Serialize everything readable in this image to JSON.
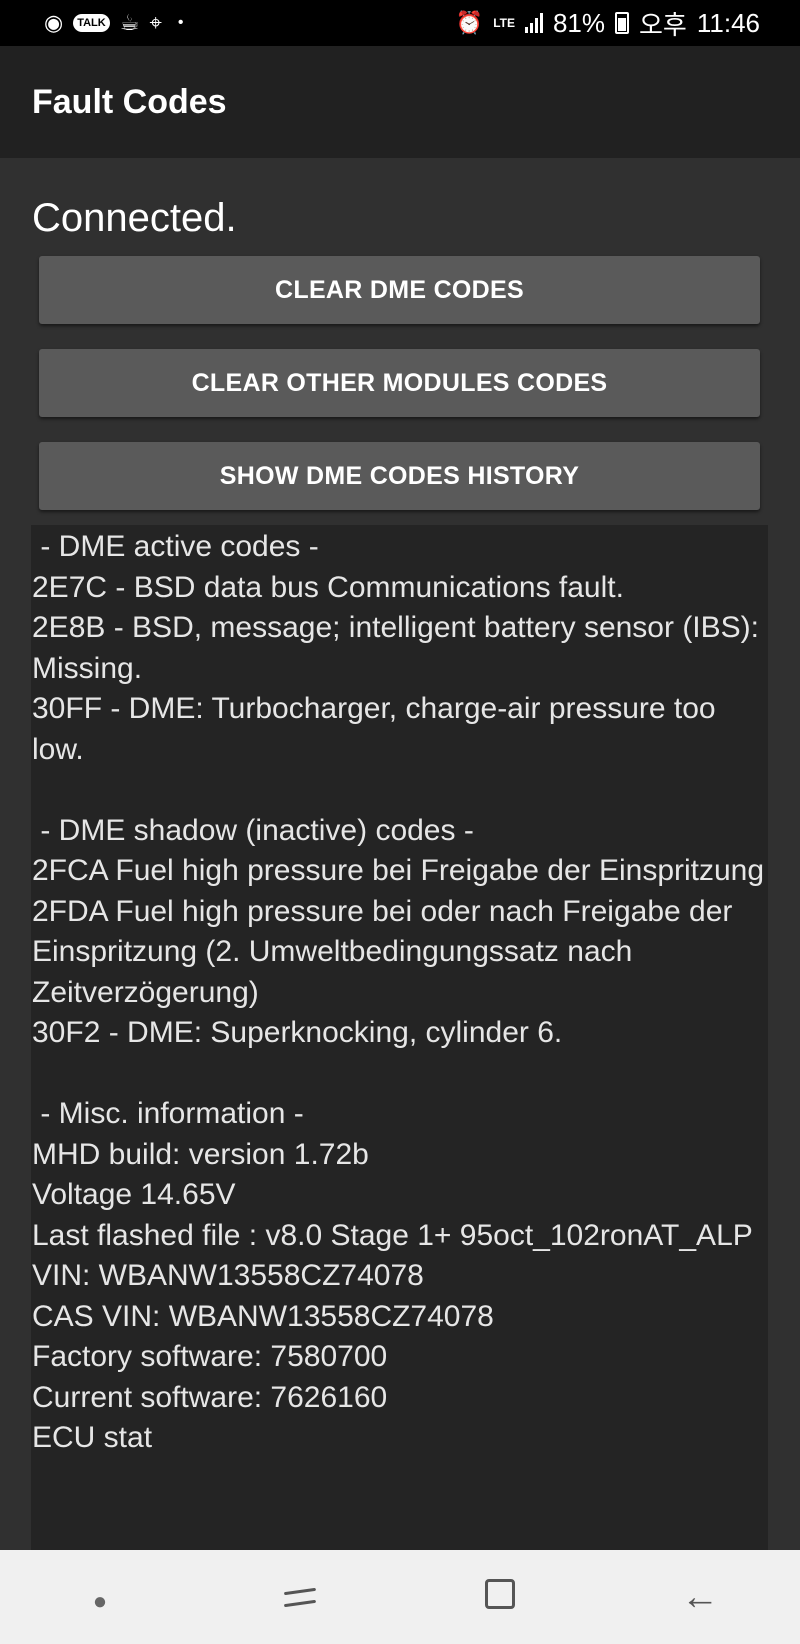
{
  "status_bar": {
    "battery_percent": "81%",
    "time_prefix": "오후",
    "time": "11:46",
    "network": "LTE",
    "talk_label": "TALK",
    "left_icons": [
      "line-icon",
      "kakaotalk-icon",
      "coffee-icon",
      "maps-icon",
      "dot-icon"
    ],
    "right_icons": [
      "alarm-icon",
      "lte-icon",
      "signal-icon",
      "battery-icon"
    ]
  },
  "app_bar": {
    "title": "Fault Codes"
  },
  "main": {
    "status": "Connected.",
    "buttons": {
      "clear_dme": "CLEAR DME CODES",
      "clear_other": "CLEAR OTHER MODULES CODES",
      "show_history": "SHOW DME CODES HISTORY"
    },
    "log_lines": [
      " - DME active codes -",
      "2E7C - BSD data bus Communications fault.",
      "2E8B - BSD, message; intelligent battery sensor (IBS): Missing.",
      "30FF - DME: Turbocharger, charge-air pressure too low.",
      "",
      " - DME shadow (inactive) codes -",
      "2FCA Fuel high pressure bei Freigabe der Einspritzung",
      "2FDA Fuel high pressure bei oder nach Freigabe der Einspritzung (2. Umweltbedingungssatz nach Zeitverzögerung)",
      "30F2 - DME: Superknocking, cylinder 6.",
      "",
      " - Misc. information -",
      "MHD build: version 1.72b",
      "Voltage 14.65V",
      "Last flashed file : v8.0 Stage 1+ 95oct_102ronAT_ALP",
      "VIN: WBANW13558CZ74078",
      "CAS VIN: WBANW13558CZ74078",
      "Factory software: 7580700",
      "Current software: 7626160",
      "ECU stat"
    ]
  },
  "nav_bar": {
    "items": [
      "dot-icon",
      "recent-apps-icon",
      "home-icon",
      "back-icon"
    ]
  },
  "colors": {
    "status_bar_bg": "#000000",
    "app_bar_bg": "#212121",
    "content_bg": "#303030",
    "button_bg": "#5a5a5a",
    "log_bg": "#242424",
    "nav_bar_bg": "#f0f0f0"
  }
}
